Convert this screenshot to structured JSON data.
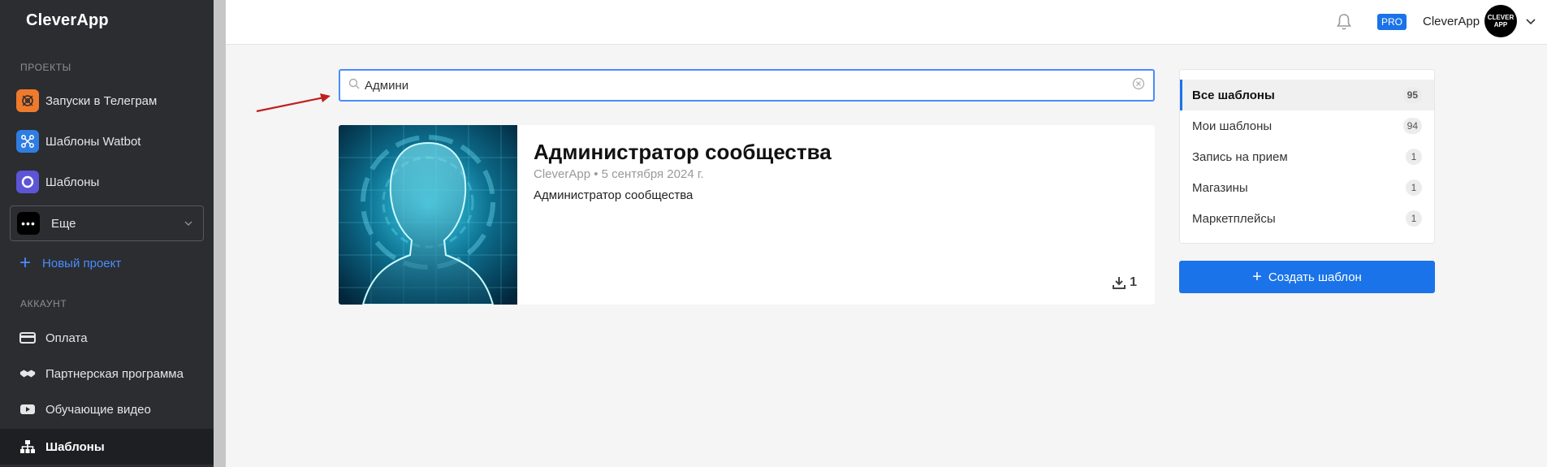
{
  "sidebar": {
    "logo": "CleverApp",
    "projects_title": "ПРОЕКТЫ",
    "projects": [
      {
        "label": "Запуски в Телеграм",
        "icon": "telegram-launch-icon",
        "color": "#f07a2c"
      },
      {
        "label": "Шаблоны Watbot",
        "icon": "watbot-icon",
        "color": "#2f7de1"
      },
      {
        "label": "Шаблоны",
        "icon": "templates-circle-icon",
        "color": "#5c55d6"
      }
    ],
    "more_label": "Еще",
    "new_project_label": "Новый проект",
    "account_title": "АККАУНТ",
    "account_items": [
      {
        "label": "Оплата",
        "icon": "card-icon"
      },
      {
        "label": "Партнерская программа",
        "icon": "handshake-icon"
      },
      {
        "label": "Обучающие видео",
        "icon": "video-icon"
      },
      {
        "label": "Шаблоны",
        "icon": "sitemap-icon",
        "active": true
      }
    ]
  },
  "header": {
    "pro_badge": "PRO",
    "user_name": "CleverApp",
    "avatar_text": "CLEVER APP"
  },
  "search": {
    "value": "Админи"
  },
  "result_card": {
    "title": "Администратор сообщества",
    "meta": "CleverApp • 5 сентября 2024 г.",
    "description": "Администратор сообщества",
    "downloads": "1"
  },
  "categories": [
    {
      "label": "Все шаблоны",
      "count": "95",
      "active": true
    },
    {
      "label": "Мои шаблоны",
      "count": "94"
    },
    {
      "label": "Запись на прием",
      "count": "1"
    },
    {
      "label": "Магазины",
      "count": "1"
    },
    {
      "label": "Маркетплейсы",
      "count": "1"
    }
  ],
  "create_button_label": "Создать шаблон",
  "colors": {
    "accent": "#1a73e8",
    "sidebar_bg": "#2b2d31",
    "annotation_arrow": "#c0201f"
  }
}
